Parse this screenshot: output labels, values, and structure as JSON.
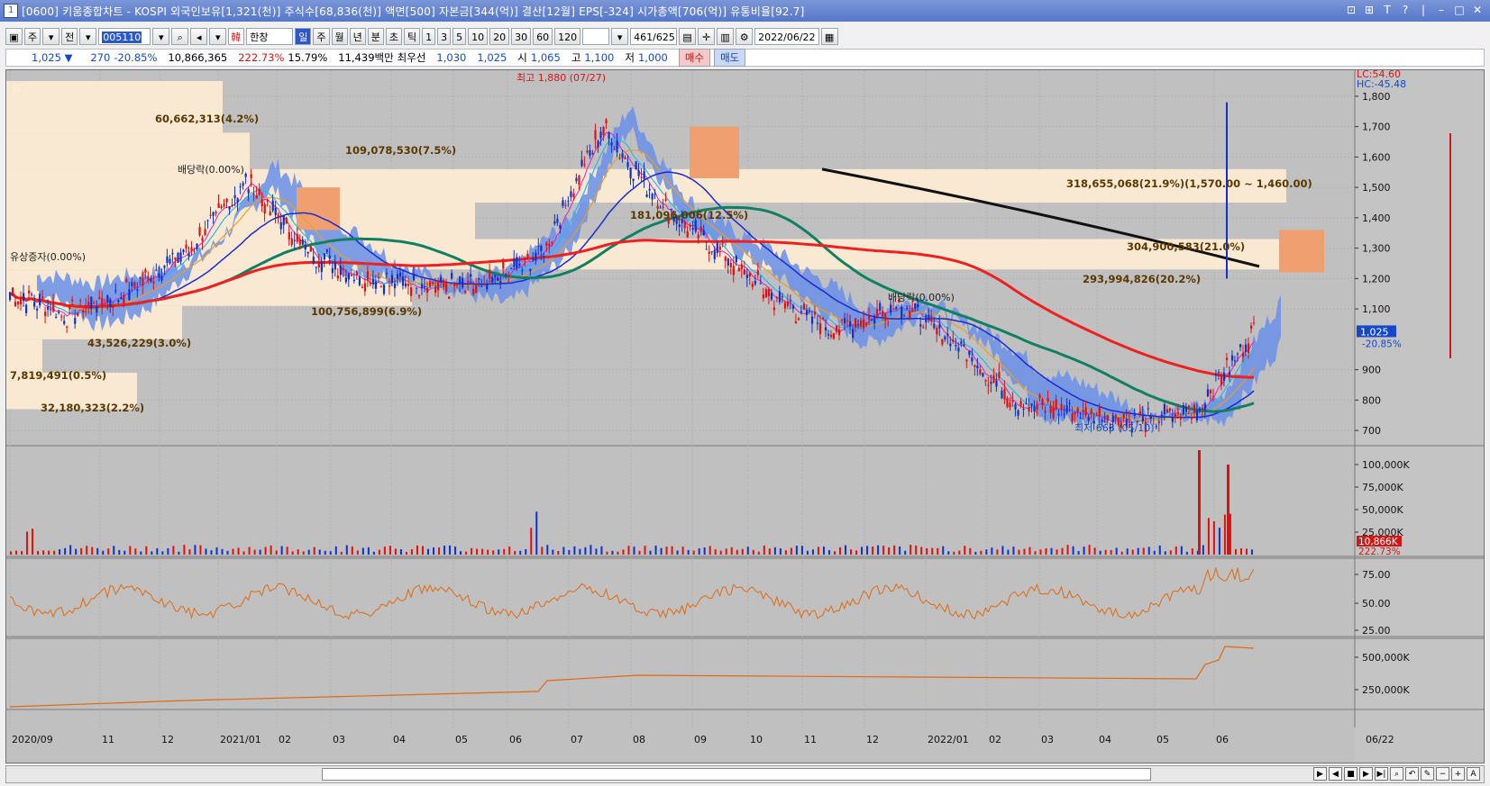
{
  "window": {
    "icon": "1",
    "title": "[0600] 키움종합차트 - KOSPI 외국인보유[1,321(천)] 주식수[68,836(천)] 액면[500] 자본금[344(억)] 결산[12월] EPS[-324] 시가총액[706(억)] 유통비율[92.7]",
    "controls": [
      "⊡",
      "⊞",
      "T",
      "?",
      "|",
      "–",
      "□",
      "✕"
    ]
  },
  "toolbar": {
    "period_a": "주",
    "period_b": "전",
    "code": "005110",
    "name": "한창",
    "name_badge": "韓",
    "periods": [
      "일",
      "주",
      "월",
      "년",
      "분",
      "초",
      "틱"
    ],
    "active_period": "일",
    "intervals": [
      "1",
      "3",
      "5",
      "10",
      "20",
      "30",
      "60",
      "120"
    ],
    "count": "461",
    "total": "/625",
    "date": "2022/06/22"
  },
  "quote": {
    "price": "1,025 ▼",
    "change": "270",
    "change_rate": "-20.85%",
    "volume": "10,866,365",
    "vol_rate": "222.73%",
    "turnover": "15.79%",
    "amount": "11,439백만",
    "best_label": "최우선",
    "best_ask": "1,030",
    "best_bid": "1,025",
    "open_label": "시",
    "open": "1,065",
    "high_label": "고",
    "high": "1,100",
    "low_label": "저",
    "low": "1,000",
    "buy": "매수",
    "sell": "매도"
  },
  "chart_data": {
    "type": "candlestick",
    "price_axis": {
      "ticks": [
        "1,800",
        "1,700",
        "1,600",
        "1,500",
        "1,400",
        "1,300",
        "1,200",
        "1,100",
        "900",
        "800",
        "700"
      ],
      "ylim": [
        650,
        1850
      ]
    },
    "x_labels": [
      "2020/09",
      "11",
      "12",
      "2021/01",
      "02",
      "03",
      "04",
      "05",
      "06",
      "07",
      "08",
      "09",
      "10",
      "11",
      "12",
      "2022/01",
      "02",
      "03",
      "04",
      "05",
      "06"
    ],
    "right_date": "06/22",
    "lc": "LC:54.60",
    "hc": "HC:-45.48",
    "current_price": "1,025",
    "current_change": "-20.85%",
    "high_note": "최고 1,880 (07/27)",
    "low_note": "최저 663 (05/10)",
    "dividend_notes": [
      "배당락(0.00%)",
      "배당락(0.00%)",
      "유상증자(0.00%)"
    ],
    "volume_profile_labels": [
      "60,662,313(4.2%)",
      "109,078,530(7.5%)",
      "318,655,068(21.9%)(1,570.00 ~ 1,460.00)",
      "181,096,006(12.5%)",
      "304,900,583(21.0%)",
      "293,994,826(20.2%)",
      "100,756,899(6.9%)",
      "43,526,229(3.0%)",
      "7,819,491(0.5%)",
      "32,180,323(2.2%)"
    ],
    "volume_axis": {
      "ticks": [
        "100,000K",
        "75,000K",
        "50,000K",
        "25,000K"
      ],
      "current": "10,866K",
      "current_rate": "222.73%"
    },
    "osc_axis": {
      "ticks": [
        "75.00",
        "50.00",
        "25.00"
      ]
    },
    "obv_axis": {
      "ticks": [
        "500,000K",
        "250,000K"
      ]
    },
    "monthly_close": [
      {
        "m": "2020/09",
        "v": 1150
      },
      {
        "m": "10",
        "v": 1080
      },
      {
        "m": "11",
        "v": 1160
      },
      {
        "m": "12",
        "v": 1290
      },
      {
        "m": "2021/01",
        "v": 1520
      },
      {
        "m": "02",
        "v": 1290
      },
      {
        "m": "03",
        "v": 1200
      },
      {
        "m": "04",
        "v": 1180
      },
      {
        "m": "05",
        "v": 1170
      },
      {
        "m": "06",
        "v": 1290
      },
      {
        "m": "07",
        "v": 1700
      },
      {
        "m": "08",
        "v": 1440
      },
      {
        "m": "09",
        "v": 1280
      },
      {
        "m": "10",
        "v": 1120
      },
      {
        "m": "11",
        "v": 1030
      },
      {
        "m": "12",
        "v": 1120
      },
      {
        "m": "2022/01",
        "v": 980
      },
      {
        "m": "02",
        "v": 790
      },
      {
        "m": "03",
        "v": 760
      },
      {
        "m": "04",
        "v": 730
      },
      {
        "m": "05",
        "v": 760
      },
      {
        "m": "06",
        "v": 1025
      }
    ]
  },
  "colors": {
    "up": "#e01010",
    "down": "#1030c8",
    "ma_red": "#ee2020",
    "ma_green": "#108060",
    "ma_blue": "#1a2ad0",
    "ma_black": "#111111",
    "cloud_blue": "#6a8fe8",
    "cloud_orange": "#f0a070",
    "profile": "#fcebd4",
    "osc": "#e06a10"
  }
}
